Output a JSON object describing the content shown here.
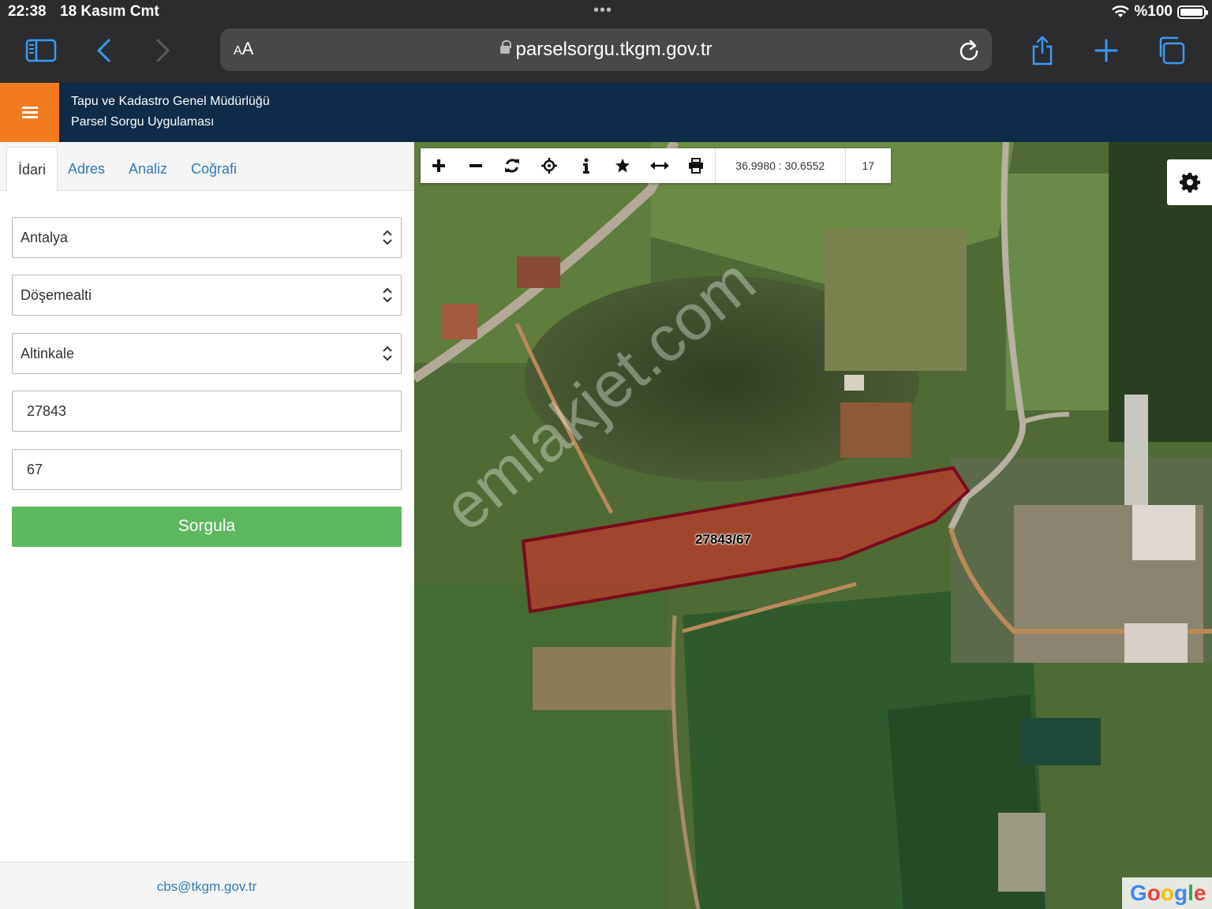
{
  "status_bar": {
    "time": "22:38",
    "date": "18 Kasım Cmt",
    "battery": "%100"
  },
  "browser": {
    "text_size_label_small": "A",
    "text_size_label_large": "A",
    "url": "parselsorgu.tkgm.gov.tr"
  },
  "header": {
    "title_line1": "Tapu ve Kadastro Genel Müdürlüğü",
    "title_line2": "Parsel Sorgu Uygulaması"
  },
  "tabs": [
    {
      "label": "İdari",
      "active": true
    },
    {
      "label": "Adres",
      "active": false
    },
    {
      "label": "Analiz",
      "active": false
    },
    {
      "label": "Coğrafi",
      "active": false
    }
  ],
  "form": {
    "il": "Antalya",
    "ilce": "Döşemealti",
    "mahalle": "Altinkale",
    "ada": "27843",
    "parsel": "67",
    "submit_label": "Sorgula"
  },
  "footer": {
    "email": "cbs@tkgm.gov.tr"
  },
  "map": {
    "toolbar_icons": [
      "zoom-in-icon",
      "zoom-out-icon",
      "refresh-icon",
      "locate-icon",
      "info-icon",
      "star-icon",
      "measure-icon",
      "print-icon"
    ],
    "coordinates": "36.9980 : 30.6552",
    "zoom_level": "17",
    "parcel_label": "27843/67",
    "attribution": "Google",
    "watermark": "emlakjet.com",
    "parcel_color": "#c0392b",
    "parcel_border_color": "#7a0a1e"
  }
}
